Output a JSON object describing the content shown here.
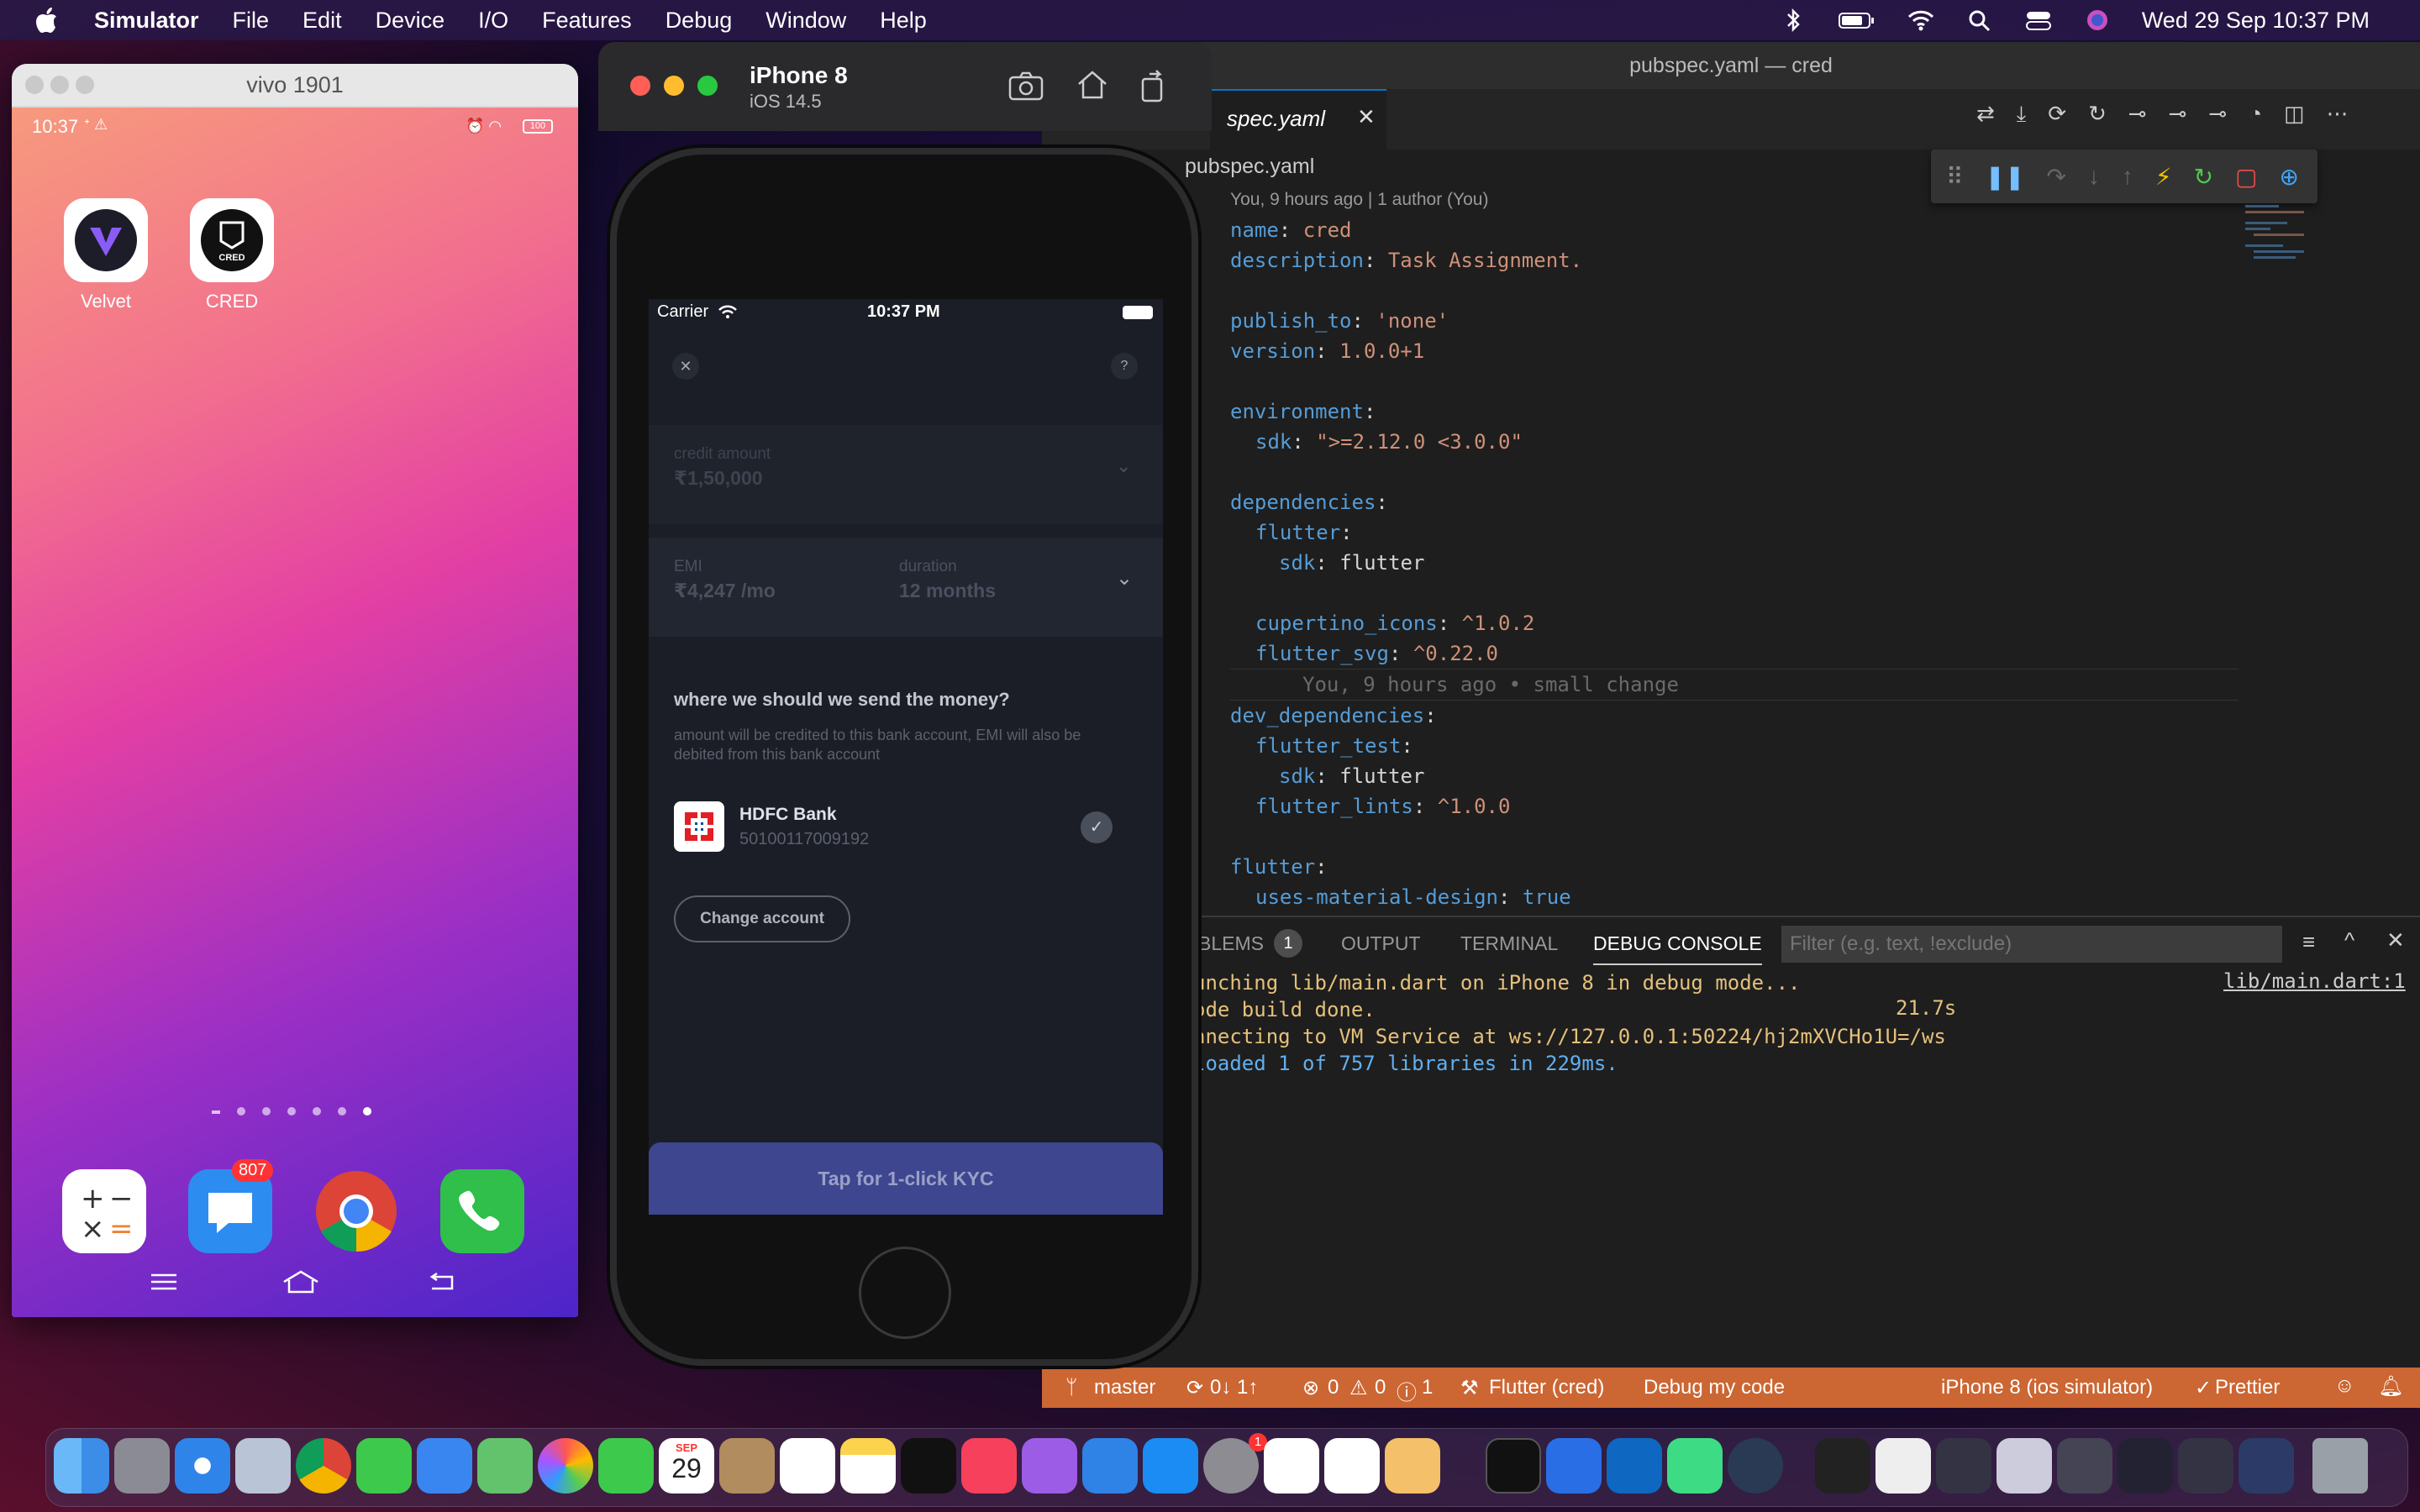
{
  "menubar": {
    "app": "Simulator",
    "items": [
      "File",
      "Edit",
      "Device",
      "I/O",
      "Features",
      "Debug",
      "Window",
      "Help"
    ],
    "clock": "Wed 29 Sep  10:37 PM"
  },
  "vivo": {
    "title": "vivo 1901",
    "status_time": "10:37",
    "battery": "100",
    "apps": [
      "Velvet",
      "CRED"
    ],
    "messages_badge": "807"
  },
  "simulator": {
    "device": "iPhone 8",
    "os": "iOS 14.5"
  },
  "ios": {
    "carrier": "Carrier",
    "time": "10:37 PM",
    "help": "?",
    "credit_label": "credit amount",
    "credit_value": "₹1,50,000",
    "emi_label": "EMI",
    "emi_value": "₹4,247 /mo",
    "duration_label": "duration",
    "duration_value": "12 months",
    "send_title": "where we should we send the money?",
    "send_sub": "amount will be credited to this bank account, EMI will also be debited from this bank account",
    "bank_name": "HDFC Bank",
    "bank_account": "50100117009192",
    "change_account": "Change account",
    "cta": "Tap for 1-click KYC"
  },
  "vscode": {
    "window_title": "pubspec.yaml — cred",
    "tab": "spec.yaml",
    "breadcrumb": "pubspec.yaml",
    "blame": "You, 9 hours ago | 1 author (You)",
    "inline_blame": "You, 9 hours ago • small change",
    "code": {
      "name_key": "name",
      "name_val": "cred",
      "desc_key": "description",
      "desc_val": "Task Assignment.",
      "publish_key": "publish_to",
      "publish_val": "'none'",
      "version_key": "version",
      "version_val": "1.0.0+1",
      "env_key": "environment",
      "sdk_key": "sdk",
      "sdk_val": "\">=2.12.0 <3.0.0\"",
      "deps_key": "dependencies",
      "flutter_key": "flutter",
      "sdk_flutter_val": "flutter",
      "cupertino_key": "cupertino_icons",
      "cupertino_val": "^1.0.2",
      "svg_key": "flutter_svg",
      "svg_val": "^0.22.0",
      "devdeps_key": "dev_dependencies",
      "flutter_test_key": "flutter_test",
      "lints_key": "flutter_lints",
      "lints_val": "^1.0.0",
      "material_key": "uses-material-design",
      "material_val": "true"
    },
    "panel": {
      "problems": "BLEMS",
      "problems_count": "1",
      "output": "OUTPUT",
      "terminal": "TERMINAL",
      "debug_console": "DEBUG CONSOLE",
      "filter_placeholder": "Filter (e.g. text, !exclude)",
      "lines": [
        "unching lib/main.dart on iPhone 8 in debug mode...",
        "ode build done.",
        "nnecting to VM Service at ws://127.0.0.1:50224/hj2mXVCHo1U=/ws",
        "loaded 1 of 757 libraries in 229ms."
      ],
      "build_time": "21.7s",
      "source_link": "lib/main.dart:1"
    },
    "statusbar": {
      "branch": "master",
      "sync": "0↓ 1↑",
      "errors": "0",
      "warnings": "0",
      "infos": "1",
      "flutter": "Flutter (cred)",
      "debug": "Debug my code",
      "device": "iPhone 8 (ios simulator)",
      "prettier": "Prettier"
    }
  },
  "dock": {
    "calendar_month": "SEP",
    "calendar_day": "29",
    "settings_badge": "1"
  }
}
